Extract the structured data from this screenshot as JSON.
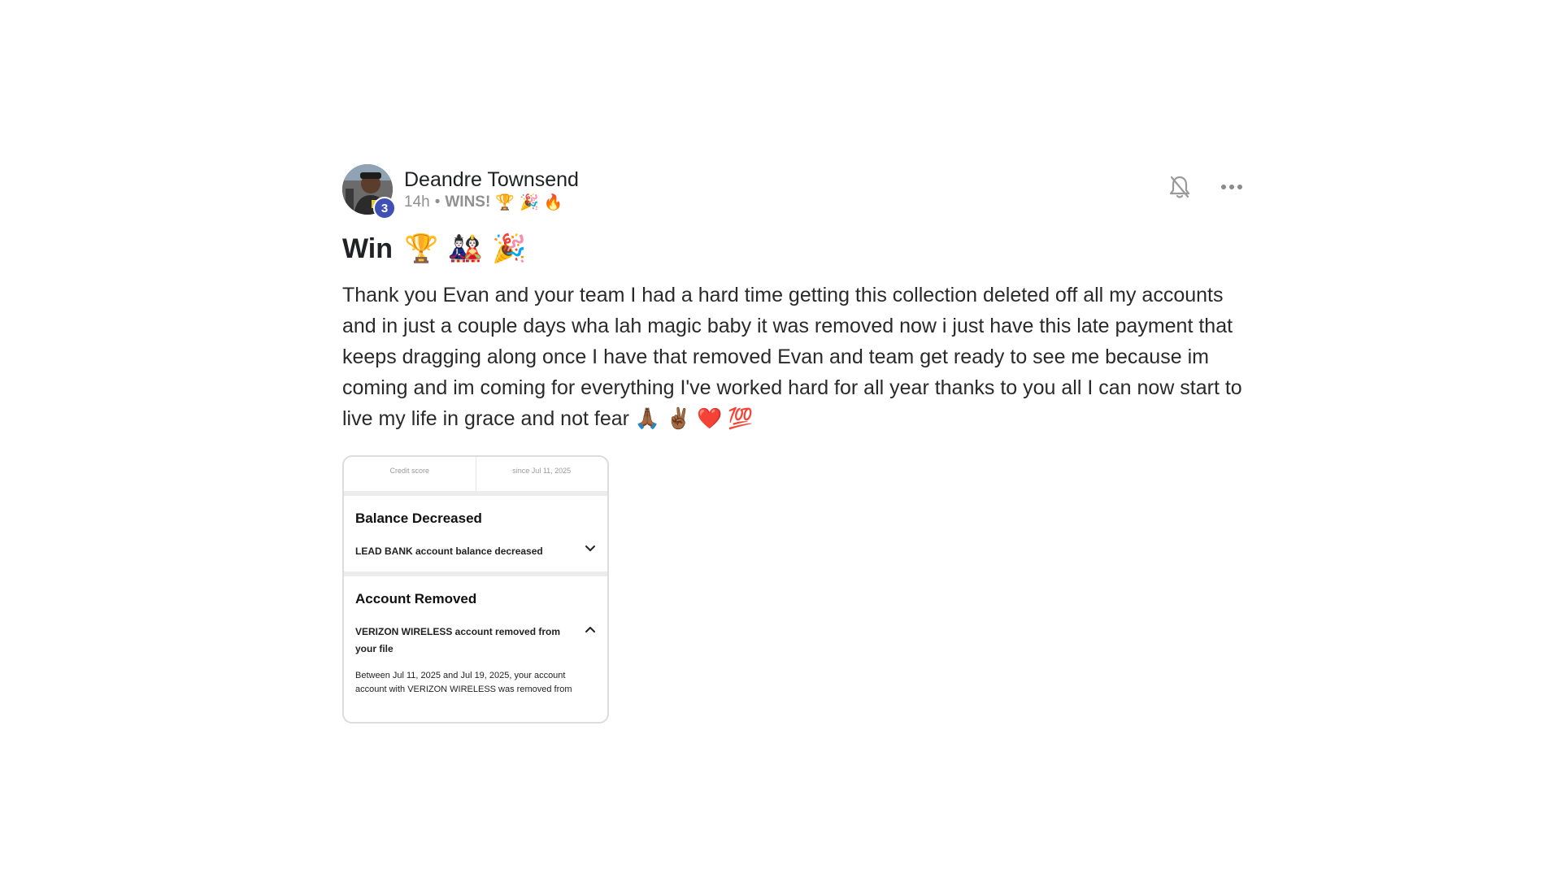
{
  "post": {
    "author": {
      "name": "Deandre Townsend",
      "level": "3",
      "avatar_icon": "user-avatar-photo"
    },
    "meta": {
      "time": "14h",
      "separator": "•",
      "category": "WINS!",
      "emojis": "🏆 🎉 🔥"
    },
    "actions": {
      "notify_icon": "bell-off-icon",
      "more_icon": "more-horizontal-icon"
    },
    "title": {
      "text": "Win",
      "emojis": "🏆 🎎 🎉"
    },
    "body": "Thank you Evan and your team I had a hard time getting this collection deleted off all my accounts and in just a couple days wha lah magic baby it was removed now i just have this late payment that keeps dragging along once I have that removed Evan and team get ready to see me because im coming and im coming for everything I've worked hard for all year thanks to you all I can now start to live my life in grace and not fear 🙏🏾 ✌🏾 ❤️ 💯",
    "attachment": {
      "top_cells": [
        {
          "value": "",
          "caption": "Credit score"
        },
        {
          "value": "",
          "caption": "since Jul 11, 2025"
        }
      ],
      "sections": [
        {
          "heading": "Balance Decreased",
          "row": "LEAD BANK account balance decreased",
          "toggle_icon": "chevron-down-icon"
        },
        {
          "heading": "Account Removed",
          "row": "VERIZON WIRELESS account removed from your file",
          "toggle_icon": "chevron-up-icon",
          "detail": "Between Jul 11, 2025 and Jul 19, 2025, your account account with VERIZON WIRELESS was removed from"
        }
      ]
    }
  }
}
